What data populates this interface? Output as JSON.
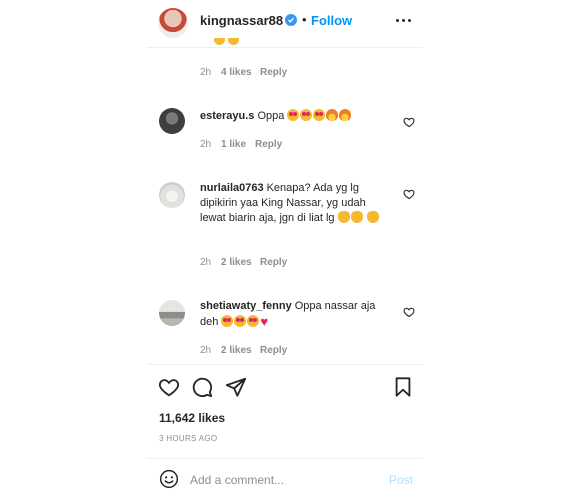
{
  "header": {
    "username": "kingnassar88",
    "separator": "•",
    "follow_label": "Follow"
  },
  "previous_comment": {
    "time": "2h",
    "likes": "4 likes",
    "reply": "Reply"
  },
  "comments": [
    {
      "username": "esterayu.s",
      "text": "Oppa",
      "time": "2h",
      "likes": "1 like",
      "reply": "Reply"
    },
    {
      "username": "nurlaila0763",
      "text": "Kenapa? Ada yg lg dipikirin yaa King Nassar, yg udah lewat biarin aja, jgn di liat lg",
      "time": "2h",
      "likes": "2 likes",
      "reply": "Reply"
    },
    {
      "username": "shetiawaty_fenny",
      "text": "Oppa nassar aja deh",
      "time": "2h",
      "likes": "2 likes",
      "reply": "Reply"
    }
  ],
  "post": {
    "like_count": "11,642 likes",
    "time_ago": "3 HOURS AGO"
  },
  "add_comment": {
    "placeholder": "Add a comment...",
    "post_label": "Post"
  },
  "colors": {
    "accent": "#0095f6",
    "post_disabled": "#b2dffc",
    "verified": "#3897f0",
    "muted": "#8e8e8e"
  },
  "icons": {
    "like": "heart-outline-icon",
    "comment": "comment-bubble-icon",
    "share": "paper-plane-icon",
    "save": "bookmark-icon",
    "emoji": "smiley-icon",
    "more": "ellipsis-icon"
  }
}
